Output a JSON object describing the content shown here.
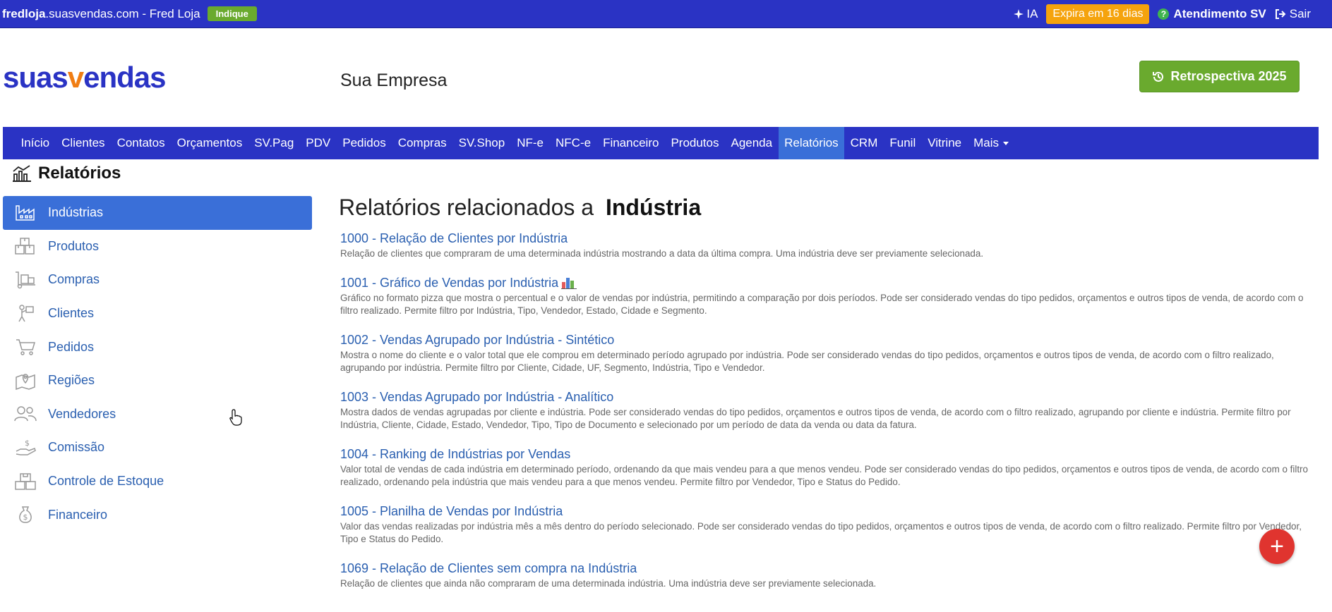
{
  "topbar": {
    "site_bold": "fredloja",
    "site_rest": ".suasvendas.com - Fred Loja",
    "indique": "Indique",
    "ia": "IA",
    "expira": "Expira em 16 dias",
    "atendimento": "Atendimento SV",
    "sair": "Sair"
  },
  "header": {
    "logo_part1": "suas",
    "logo_v": "v",
    "logo_part2": "endas",
    "company": "Sua Empresa",
    "retro_label": "Retrospectiva 2025"
  },
  "nav": [
    "Início",
    "Clientes",
    "Contatos",
    "Orçamentos",
    "SV.Pag",
    "PDV",
    "Pedidos",
    "Compras",
    "SV.Shop",
    "NF-e",
    "NFC-e",
    "Financeiro",
    "Produtos",
    "Agenda",
    "Relatórios",
    "CRM",
    "Funil",
    "Vitrine",
    "Mais"
  ],
  "page_title": "Relatórios",
  "sidebar": [
    {
      "label": "Indústrias",
      "icon": "factory-icon"
    },
    {
      "label": "Produtos",
      "icon": "boxes-icon"
    },
    {
      "label": "Compras",
      "icon": "dolly-icon"
    },
    {
      "label": "Clientes",
      "icon": "person-sign-icon"
    },
    {
      "label": "Pedidos",
      "icon": "cart-icon"
    },
    {
      "label": "Regiões",
      "icon": "map-pin-icon"
    },
    {
      "label": "Vendedores",
      "icon": "users-icon"
    },
    {
      "label": "Comissão",
      "icon": "hand-dollar-icon"
    },
    {
      "label": "Controle de Estoque",
      "icon": "stock-boxes-icon"
    },
    {
      "label": "Financeiro",
      "icon": "money-bag-icon"
    }
  ],
  "main": {
    "title_prefix": "Relatórios relacionados a",
    "title_bold": "Indústria",
    "reports": [
      {
        "title": "1000 - Relação de Clientes por Indústria",
        "desc": "Relação de clientes que compraram de uma determinada indústria mostrando a data da última compra. Uma indústria deve ser previamente selecionada."
      },
      {
        "title": "1001 - Gráfico de Vendas por Indústria",
        "desc": "Gráfico no formato pizza que mostra o percentual e o valor de vendas por indústria, permitindo a comparação por dois períodos. Pode ser considerado vendas do tipo pedidos, orçamentos e outros tipos de venda, de acordo com o filtro realizado. Permite filtro por Indústria, Tipo, Vendedor, Estado, Cidade e Segmento."
      },
      {
        "title": "1002 - Vendas Agrupado por Indústria - Sintético",
        "desc": "Mostra o nome do cliente e o valor total que ele comprou em determinado período agrupado por indústria. Pode ser considerado vendas do tipo pedidos, orçamentos e outros tipos de venda, de acordo com o filtro realizado, agrupando por indústria. Permite filtro por Cliente, Cidade, UF, Segmento, Indústria, Tipo e Vendedor."
      },
      {
        "title": "1003 - Vendas Agrupado por Indústria - Analítico",
        "desc": "Mostra dados de vendas agrupadas por cliente e indústria. Pode ser considerado vendas do tipo pedidos, orçamentos e outros tipos de venda, de acordo com o filtro realizado, agrupando por cliente e indústria. Permite filtro por Indústria, Cliente, Cidade, Estado, Vendedor, Tipo, Tipo de Documento e selecionado por um período de data da venda ou data da fatura."
      },
      {
        "title": "1004 - Ranking de Indústrias por Vendas",
        "desc": "Valor total de vendas de cada indústria em determinado período, ordenando da que mais vendeu para a que menos vendeu. Pode ser considerado vendas do tipo pedidos, orçamentos e outros tipos de venda, de acordo com o filtro realizado, ordenando pela indústria que mais vendeu para a que menos vendeu. Permite filtro por Vendedor, Tipo e Status do Pedido."
      },
      {
        "title": "1005 - Planilha de Vendas por Indústria",
        "desc": "Valor das vendas realizadas por indústria mês a mês dentro do período selecionado. Pode ser considerado vendas do tipo pedidos, orçamentos e outros tipos de venda, de acordo com o filtro realizado. Permite filtro por Vendedor, Tipo e Status do Pedido."
      },
      {
        "title": "1069 - Relação de Clientes sem compra na Indústria",
        "desc": "Relação de clientes que ainda não compraram de uma determinada indústria. Uma indústria deve ser previamente selecionada."
      }
    ]
  },
  "fab": "+"
}
